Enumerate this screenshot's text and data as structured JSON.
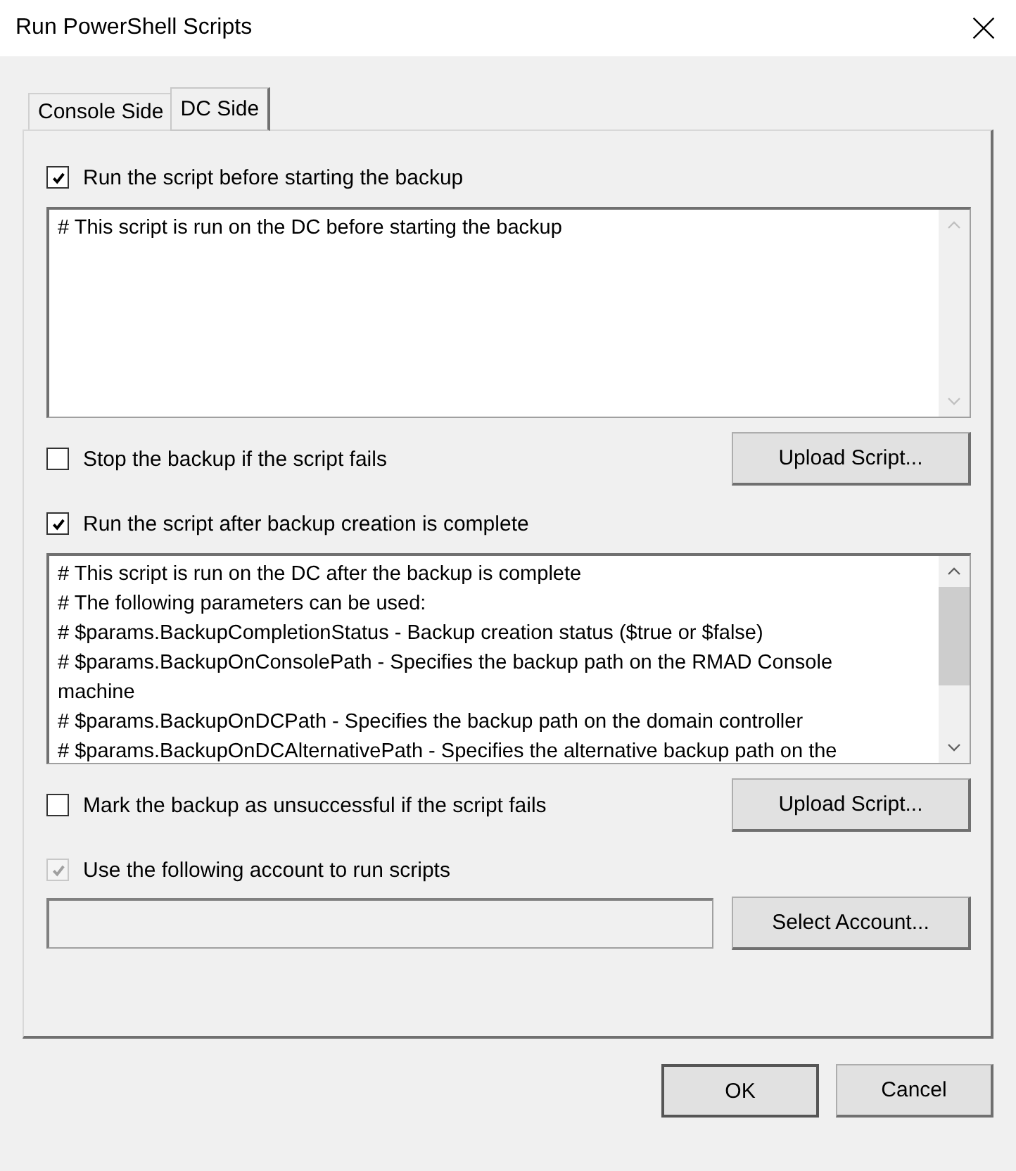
{
  "window": {
    "title": "Run PowerShell Scripts"
  },
  "tabs": [
    {
      "label": "Console Side",
      "selected": false
    },
    {
      "label": "DC Side",
      "selected": true
    }
  ],
  "before_script": {
    "checkbox": {
      "label": "Run the script before starting the backup",
      "checked": true,
      "disabled": false
    },
    "lines": [
      "# This script is run on the DC before starting the backup"
    ],
    "stop_checkbox": {
      "label": "Stop the backup if the script fails",
      "checked": false,
      "disabled": false
    },
    "upload_button": "Upload Script..."
  },
  "after_script": {
    "checkbox": {
      "label": "Run the script after backup creation is complete",
      "checked": true,
      "disabled": false
    },
    "lines": [
      "# This script is run on the DC after the backup is complete",
      "# The following parameters can be used:",
      "# $params.BackupCompletionStatus - Backup creation status ($true or $false)",
      "# $params.BackupOnConsolePath - Specifies the backup path on the RMAD Console",
      "machine",
      "# $params.BackupOnDCPath - Specifies the backup path on the domain controller",
      "# $params.BackupOnDCAlternativePath - Specifies the alternative backup path on the"
    ],
    "mark_checkbox": {
      "label": "Mark the backup as unsuccessful if the script fails",
      "checked": false,
      "disabled": false
    },
    "upload_button": "Upload Script..."
  },
  "account": {
    "checkbox": {
      "label": "Use the following account to run scripts",
      "checked": true,
      "disabled": true
    },
    "field_disabled": true,
    "select_button": "Select Account..."
  },
  "buttons": [
    "OK",
    "Cancel"
  ]
}
